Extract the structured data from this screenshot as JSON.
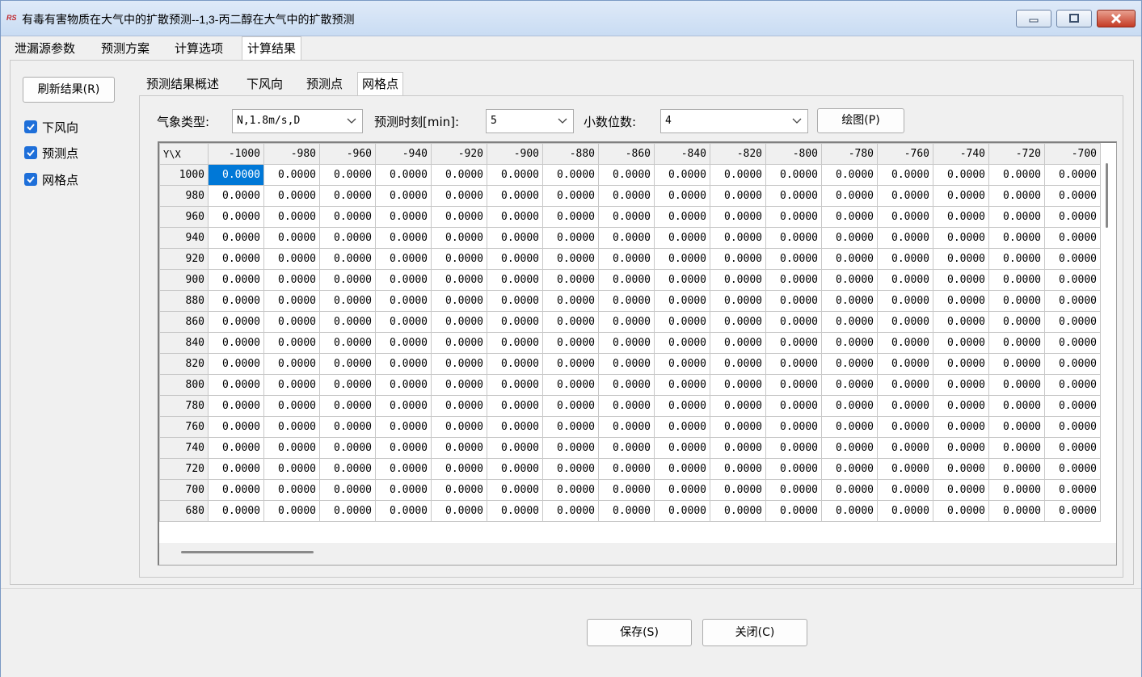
{
  "window": {
    "title": "有毒有害物质在大气中的扩散预测--1,3-丙二醇在大气中的扩散预测"
  },
  "main_tabs": [
    "泄漏源参数",
    "预测方案",
    "计算选项",
    "计算结果"
  ],
  "active_main_tab": "计算结果",
  "sidebar": {
    "refresh_label": "刷新结果(R)",
    "checkboxes": [
      {
        "label": "下风向",
        "checked": true
      },
      {
        "label": "预测点",
        "checked": true
      },
      {
        "label": "网格点",
        "checked": true
      }
    ]
  },
  "sub_tabs": [
    "预测结果概述",
    "下风向",
    "预测点",
    "网格点"
  ],
  "active_sub_tab": "网格点",
  "toolbar": {
    "weather_label": "气象类型:",
    "weather_value": "N,1.8m/s,D",
    "time_label": "预测时刻[min]:",
    "time_value": "5",
    "decimals_label": "小数位数:",
    "decimals_value": "4",
    "draw_label": "绘图(P)"
  },
  "grid": {
    "corner": "Y\\X",
    "columns": [
      "-1000",
      "-980",
      "-960",
      "-940",
      "-920",
      "-900",
      "-880",
      "-860",
      "-840",
      "-820",
      "-800",
      "-780",
      "-760",
      "-740",
      "-720",
      "-700"
    ],
    "rows": [
      "1000",
      "980",
      "960",
      "940",
      "920",
      "900",
      "880",
      "860",
      "840",
      "820",
      "800",
      "780",
      "760",
      "740",
      "720",
      "700",
      "680"
    ],
    "cell_value": "0.0000",
    "selected_cell": {
      "row": 0,
      "col": 0
    }
  },
  "footer": {
    "save_label": "保存(S)",
    "close_label": "关闭(C)"
  },
  "colors": {
    "accent": "#0078d7",
    "checkbox": "#1e6fd9",
    "close_button": "#c43b25"
  }
}
